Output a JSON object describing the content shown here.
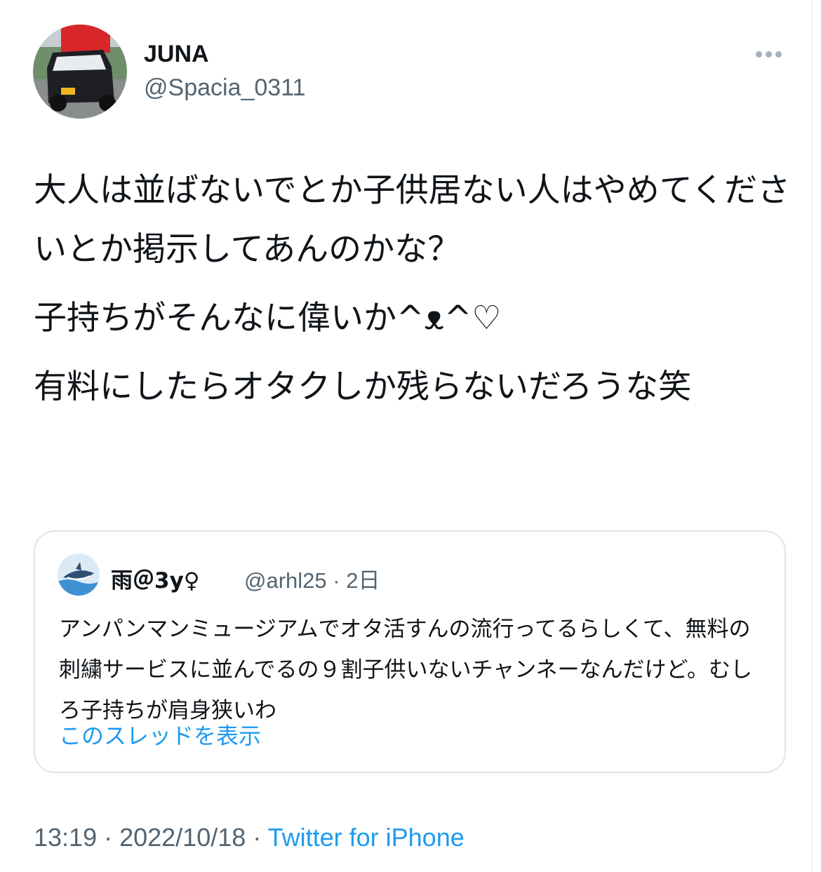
{
  "author": {
    "display_name": "JUNA",
    "handle": "@Spacia_0311",
    "avatar_icon": "car-photo-avatar"
  },
  "tweet": {
    "paragraphs": [
      "大人は並ばないでとか子供居ない人はやめてくださいとか掲示してあんのかな？",
      "子持ちがそんなに偉いか^ᴥ^♡",
      "有料にしたらオタクしか残らないだろうな笑"
    ]
  },
  "quoted_tweet": {
    "display_name": "雨＠3y♀",
    "handle": "@arhl25",
    "separator": " · ",
    "time": "2日",
    "text": "アンパンマンミュージアムでオタ活すんの流行ってるらしくて、無料の刺繍サービスに並んでるの９割子供いないチャンネーなんだけど。むしろ子持ちが肩身狭いわ",
    "thread_link": "このスレッドを表示",
    "avatar_icon": "shark-avatar"
  },
  "meta": {
    "time": "13:19",
    "date": "2022/10/18",
    "separator": " · ",
    "source": "Twitter for iPhone"
  },
  "colors": {
    "accent": "#1d9bf0",
    "text": "#0f1419",
    "muted": "#536471",
    "border": "#dfe5ea"
  }
}
